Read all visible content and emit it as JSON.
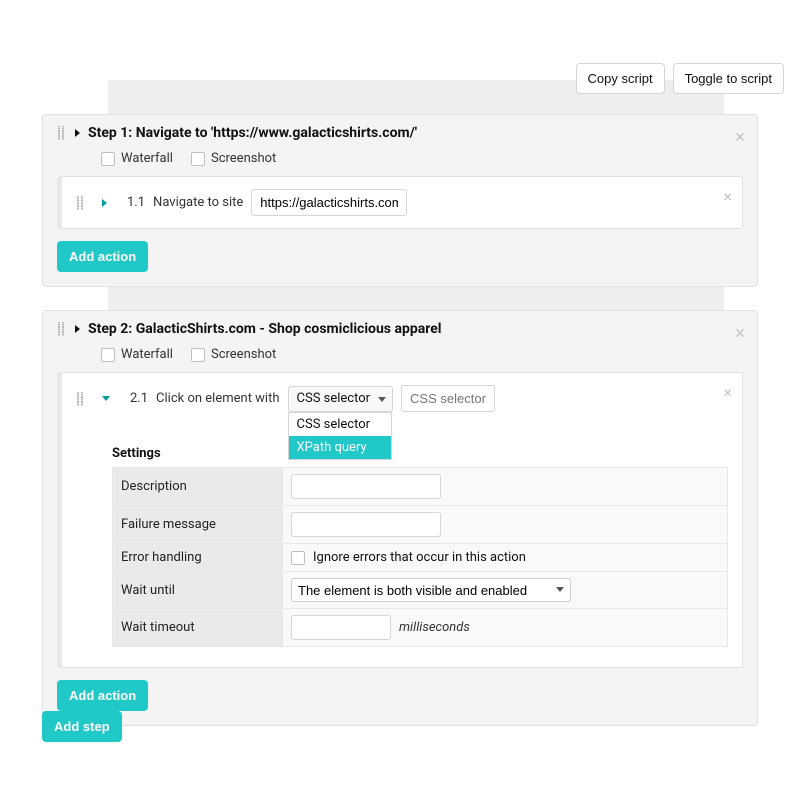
{
  "toolbar": {
    "copy_script": "Copy script",
    "toggle_to_script": "Toggle to script"
  },
  "steps": [
    {
      "title": "Step 1: Navigate to 'https://www.galacticshirts.com/'",
      "waterfall_label": "Waterfall",
      "screenshot_label": "Screenshot",
      "add_action_label": "Add action",
      "actions": [
        {
          "idx": "1.1",
          "label": "Navigate to site",
          "url": "https://galacticshirts.com"
        }
      ]
    },
    {
      "title": "Step 2: GalacticShirts.com - Shop cosmiclicious apparel",
      "waterfall_label": "Waterfall",
      "screenshot_label": "Screenshot",
      "add_action_label": "Add action",
      "actions": [
        {
          "idx": "2.1",
          "label": "Click on element with",
          "selector_type": "CSS selector",
          "selector_options": [
            "CSS selector",
            "XPath query"
          ],
          "selector_placeholder": "CSS selector",
          "settings": {
            "heading": "Settings",
            "rows": {
              "description": "Description",
              "failure_message": "Failure message",
              "error_handling": "Error handling",
              "ignore_label": "Ignore errors that occur in this action",
              "wait_until": "Wait until",
              "wait_until_value": "The element is both visible and enabled",
              "wait_timeout": "Wait timeout",
              "wait_timeout_unit": "milliseconds"
            }
          }
        }
      ]
    }
  ],
  "add_step_label": "Add step"
}
